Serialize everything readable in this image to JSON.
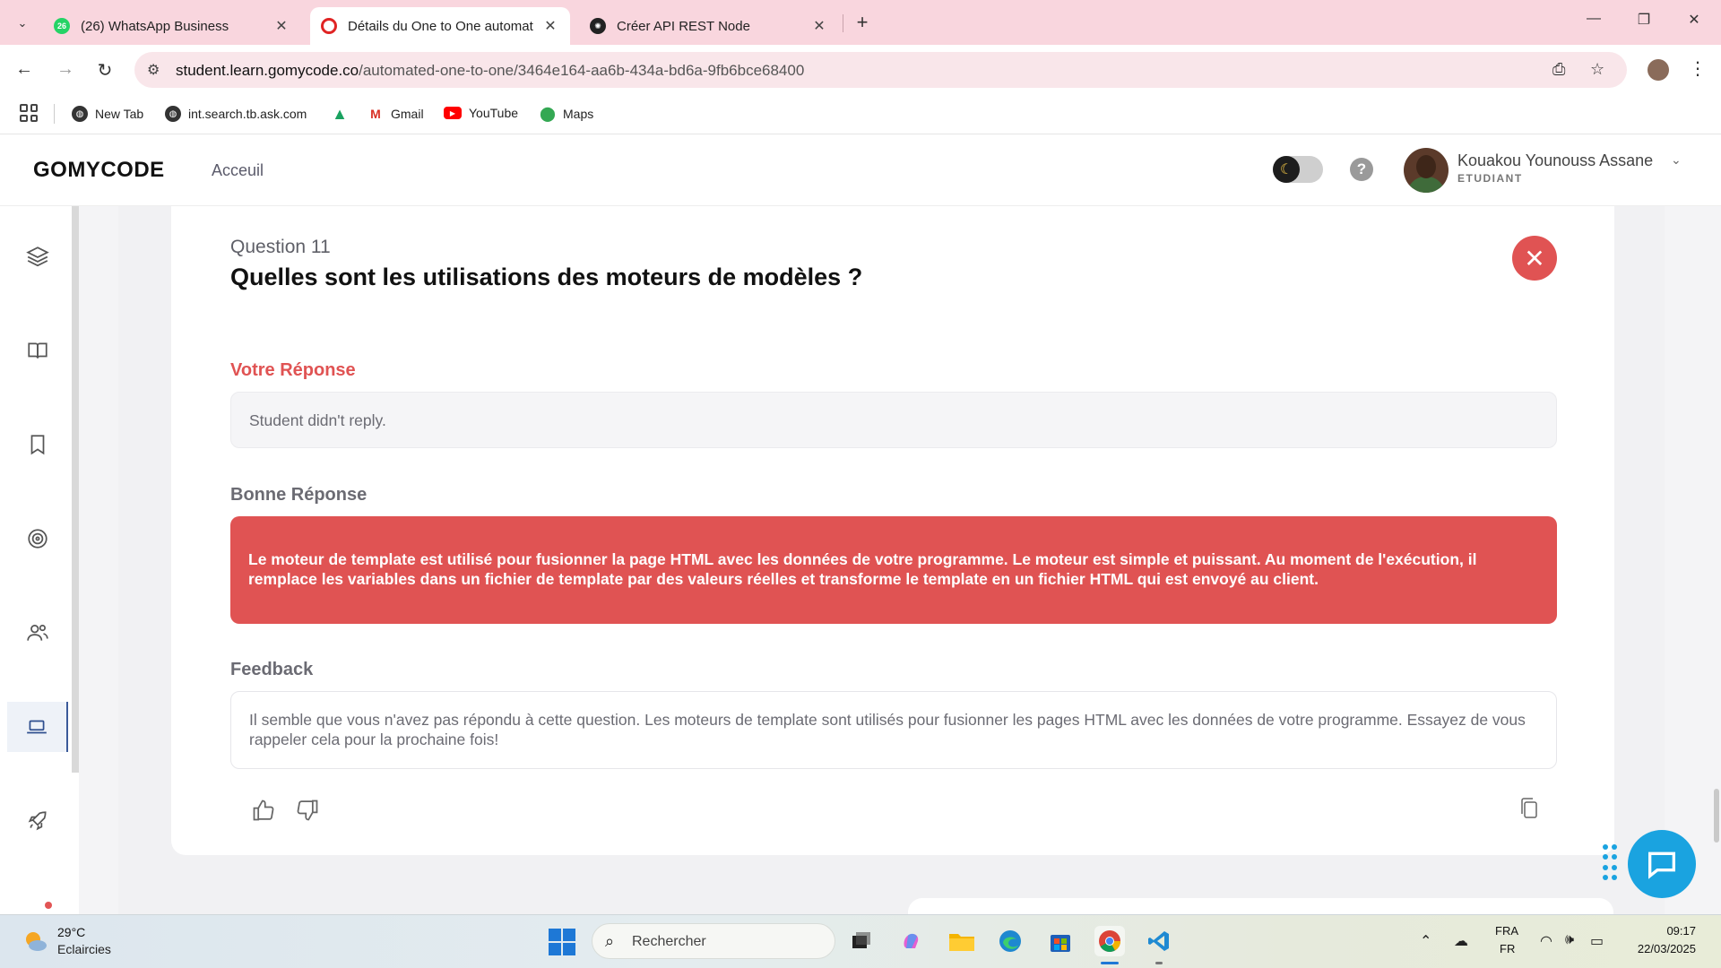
{
  "browser": {
    "tabs": [
      {
        "title": "(26) WhatsApp Business",
        "badge": "26",
        "active": false
      },
      {
        "title": "Détails du One to One automat",
        "active": true
      },
      {
        "title": "Créer API REST Node",
        "active": false
      }
    ],
    "url_host": "student.learn.gomycode.co",
    "url_path": "/automated-one-to-one/3464e164-aa6b-434a-bd6a-9fb6bce68400",
    "bookmarks": [
      "New Tab",
      "int.search.tb.ask.com",
      "Gmail",
      "YouTube",
      "Maps"
    ]
  },
  "header": {
    "logo": "GOMYCODE",
    "nav_home": "Acceuil",
    "user_name": "Kouakou Younouss Assane",
    "user_role": "ETUDIANT"
  },
  "question": {
    "number_label": "Question 11",
    "title": "Quelles sont les utilisations des moteurs de modèles ?",
    "your_answer_label": "Votre Réponse",
    "your_answer": "Student didn't reply.",
    "correct_label": "Bonne Réponse",
    "correct_answer": "Le moteur de template est utilisé pour fusionner la page HTML avec les données de votre programme. Le moteur est simple et puissant. Au moment de l'exécution, il remplace les variables dans un fichier de template par des valeurs réelles et transforme le template en un fichier HTML qui est envoyé au client.",
    "feedback_label": "Feedback",
    "feedback": "Il semble que vous n'avez pas répondu à cette question. Les moteurs de template sont utilisés pour fusionner les pages HTML avec les données de votre programme. Essayez de vous rappeler cela pour la prochaine fois!"
  },
  "taskbar": {
    "weather_temp": "29°C",
    "weather_desc": "Eclaircies",
    "search_placeholder": "Rechercher",
    "lang_top": "FRA",
    "lang_bottom": "FR",
    "time": "09:17",
    "date": "22/03/2025"
  },
  "colors": {
    "accent_red": "#e05353",
    "tab_bar": "#f9d6de",
    "chat_blue": "#1aa3e0"
  }
}
